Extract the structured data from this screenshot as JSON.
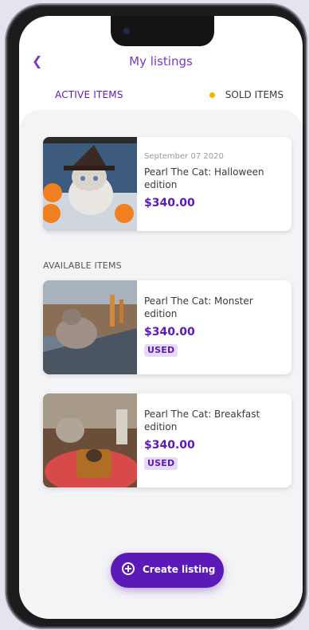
{
  "header": {
    "title": "My listings",
    "back_icon": "chevron-left-icon"
  },
  "tabs": {
    "active": "ACTIVE ITEMS",
    "sold": "SOLD ITEMS"
  },
  "featured": {
    "date": "September 07 2020",
    "name": "Pearl The Cat: Halloween edition",
    "price": "$340.00"
  },
  "section": {
    "title": "AVAILABLE ITEMS"
  },
  "items": [
    {
      "name": "Pearl The Cat: Monster edition",
      "price": "$340.00",
      "badge": "USED"
    },
    {
      "name": "Pearl The Cat: Breakfast edition",
      "price": "$340.00",
      "badge": "USED"
    }
  ],
  "create_button": {
    "label": "Create listing",
    "icon": "plus-circle-icon"
  },
  "colors": {
    "accent": "#5b1ab7",
    "title_purple": "#7a38c8",
    "dot_yellow": "#f3b300"
  }
}
